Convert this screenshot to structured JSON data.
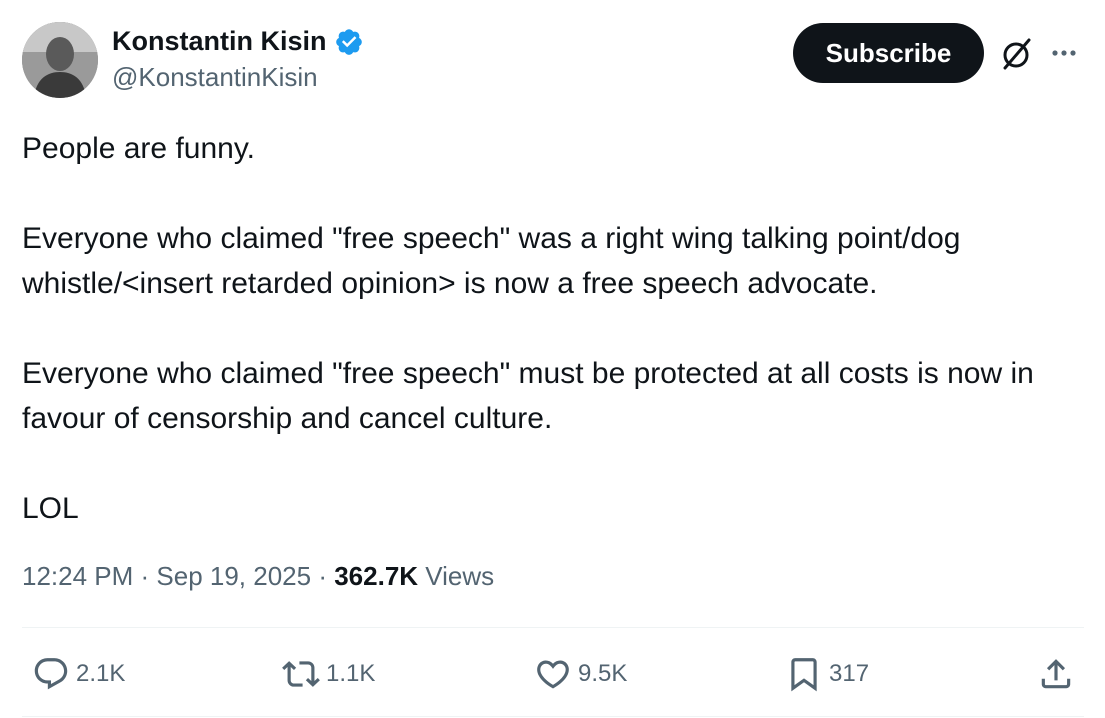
{
  "author": {
    "name": "Konstantin Kisin",
    "handle": "@KonstantinKisin",
    "verified_color": "#1d9bf0"
  },
  "header": {
    "subscribe_label": "Subscribe",
    "grok_icon": "grok-icon",
    "more_icon": "more-dots-icon"
  },
  "post": {
    "paragraphs": [
      "People are funny.",
      "Everyone who claimed \"free speech\" was a right wing talking point/dog whistle/<insert retarded opinion> is now a free speech advocate.",
      "Everyone who claimed \"free speech\" must be protected at all costs is now in favour of censorship and cancel culture.",
      "LOL"
    ],
    "time": "12:24 PM",
    "separator": " · ",
    "date": "Sep 19, 2025",
    "views_count": "362.7K",
    "views_label": " Views"
  },
  "actions": {
    "replies": "2.1K",
    "reposts": "1.1K",
    "likes": "9.5K",
    "bookmarks": "317"
  }
}
